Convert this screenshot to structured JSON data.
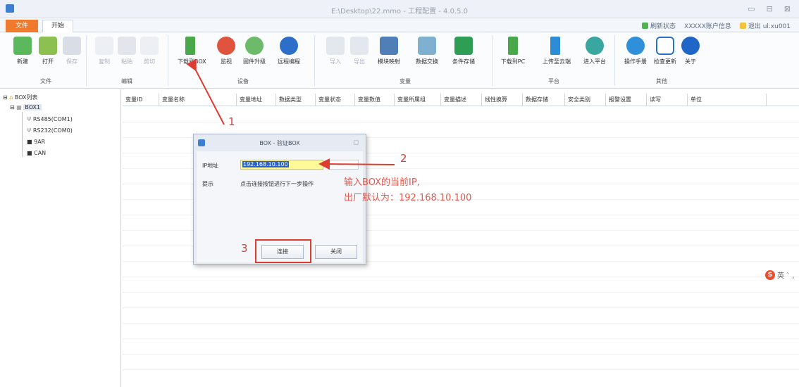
{
  "window": {
    "title": "E:\\Desktop\\22.mmo - 工程配置 - 4.0.5.0",
    "min": "▭",
    "max": "⊟",
    "close": "⊠"
  },
  "tabs": {
    "file": "文件",
    "start": "开始"
  },
  "status": {
    "refresh": "刷新状态",
    "account": "XXXXX账户信息",
    "logout": "退出 ul.xu001"
  },
  "toolbar": {
    "new": "新建",
    "open": "打开",
    "save": "保存",
    "copy": "复制",
    "paste": "粘贴",
    "cut": "剪切",
    "download_box": "下载到BOX",
    "monitor": "监视",
    "firmware": "固件升级",
    "remote": "远程编程",
    "import": "导入",
    "export": "导出",
    "module_map": "模块映射",
    "data_exchange": "数据交换",
    "cond_store": "条件存储",
    "download_pc": "下载到PC",
    "upload_cloud": "上传至云端",
    "enter_platform": "进入平台",
    "manual": "操作手册",
    "check_update": "检查更新",
    "about": "关于"
  },
  "groups": {
    "file": "文件",
    "edit": "编辑",
    "device": "设备",
    "variable": "变量",
    "platform": "平台",
    "other": "其他"
  },
  "tree": {
    "root": "BOX列表",
    "box": "BOX1",
    "children": [
      "RS485(COM1)",
      "RS232(COM0)",
      "9AR",
      "CAN"
    ]
  },
  "columns": [
    "变量ID",
    "变量名称",
    "变量地址",
    "数据类型",
    "变量状态",
    "变量数值",
    "变量所属组",
    "变量描述",
    "线性换算",
    "数据存储",
    "安全类别",
    "报警设置",
    "读写",
    "单位"
  ],
  "dialog": {
    "title": "BOX - 验证BOX",
    "ip_label": "IP地址",
    "ip_value": "192.168.10.100",
    "hint_label": "提示",
    "hint_text": "点击连接按钮进行下一步操作",
    "connect": "连接",
    "close": "关闭"
  },
  "annotations": {
    "step1": "1",
    "step2": "2",
    "step3": "3",
    "note_line1": "输入BOX的当前IP,",
    "note_line2": "出厂默认为：192.168.10.100"
  },
  "ime": {
    "logo": "S",
    "text": "英 ˋ ,"
  },
  "colors": {
    "accent_orange": "#ef7a2e",
    "annotation_red": "#e03b2f",
    "input_highlight": "#fffa99",
    "selection_blue": "#2d63c4"
  }
}
